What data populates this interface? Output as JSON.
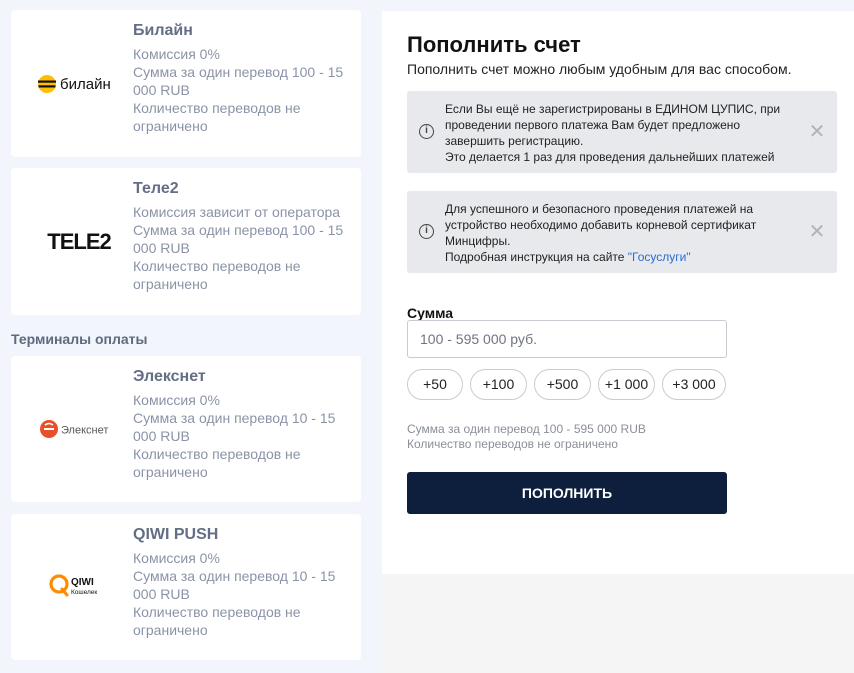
{
  "providers_top": [
    {
      "name": "Билайн",
      "logo_text": "билайн",
      "lines": [
        "Комиссия 0%",
        "Сумма за один перевод 100 - 15 000 RUB",
        "Количество переводов не ограничено"
      ]
    },
    {
      "name": "Теле2",
      "logo_text": "TELE2",
      "lines": [
        "Комиссия зависит от оператора",
        "Сумма за один перевод 100 - 15 000 RUB",
        "Количество переводов не ограничено"
      ]
    }
  ],
  "terminals_title": "Терминалы оплаты",
  "terminals": [
    {
      "name": "Элекснет",
      "logo_text": "Элекснет",
      "lines": [
        "Комиссия 0%",
        "Сумма за один перевод 10 - 15 000 RUB",
        "Количество переводов не ограничено"
      ]
    },
    {
      "name": "QIWI PUSH",
      "logo_text": "QIWI",
      "logo_sub": "Кошелек",
      "lines": [
        "Комиссия 0%",
        "Сумма за один перевод 10 - 15 000 RUB",
        "Количество переводов не ограничено"
      ]
    }
  ],
  "topup": {
    "title": "Пополнить счет",
    "subtitle": "Пополнить счет можно любым удобным для вас способом.",
    "notice1": {
      "lines": [
        "Если Вы ещё не зарегистрированы в ЕДИНОМ ЦУПИС, при проведении первого платежа Вам будет предложено завершить регистрацию.",
        "Это делается 1 раз для проведения дальнейших платежей"
      ],
      "info_icon": "i",
      "close_icon": "✕"
    },
    "notice2": {
      "text": "Для успешного и безопасного проведения платежей на устройство необходимо добавить корневой сертификат Минцифры.",
      "instruction_prefix": "Подробная инструкция на сайте ",
      "link_text": "\"Госуслуги\"",
      "info_icon": "i",
      "close_icon": "✕"
    },
    "sum_label": "Сумма",
    "sum_placeholder": "100 - 595 000 руб.",
    "sum_value": "",
    "chips": [
      "+50",
      "+100",
      "+500",
      "+1 000",
      "+3 000"
    ],
    "hint_lines": [
      "Сумма за один перевод 100 - 595 000 RUB",
      "Количество переводов не ограничено"
    ],
    "submit_label": "ПОПОЛНИТЬ"
  },
  "colors": {
    "beeline_yellow": "#ffbe00",
    "elecsnet_orange": "#e8502a",
    "qiwi_orange": "#ff8c00",
    "button_navy": "#0d1f3c",
    "link": "#2a6bd1"
  }
}
